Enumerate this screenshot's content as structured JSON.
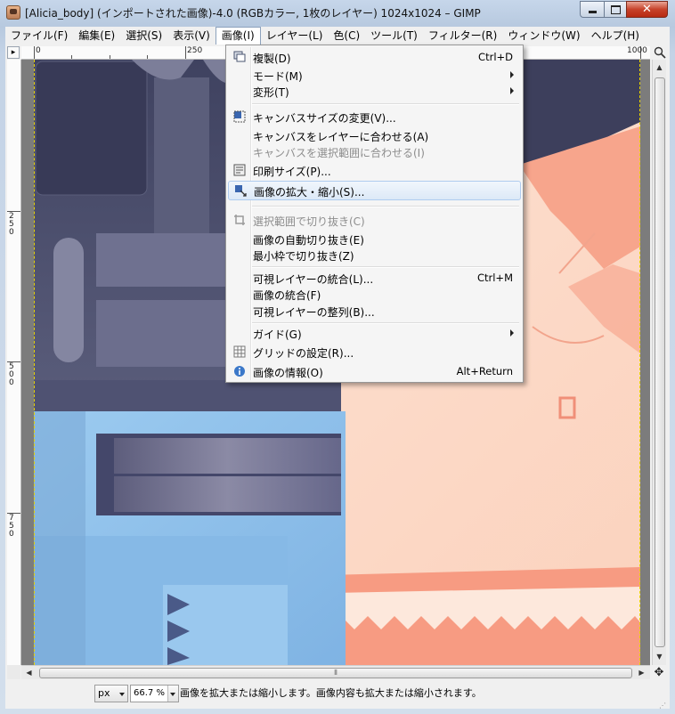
{
  "window": {
    "title": "[Alicia_body] (インポートされた画像)-4.0 (RGBカラー, 1枚のレイヤー) 1024x1024 – GIMP",
    "close_glyph": "✕"
  },
  "menubar": {
    "items": [
      {
        "label": "ファイル(F)"
      },
      {
        "label": "編集(E)"
      },
      {
        "label": "選択(S)"
      },
      {
        "label": "表示(V)"
      },
      {
        "label": "画像(I)"
      },
      {
        "label": "レイヤー(L)"
      },
      {
        "label": "色(C)"
      },
      {
        "label": "ツール(T)"
      },
      {
        "label": "フィルター(R)"
      },
      {
        "label": "ウィンドウ(W)"
      },
      {
        "label": "ヘルプ(H)"
      }
    ]
  },
  "ruler": {
    "corner": "▸",
    "h_labels": [
      "0",
      "250",
      "1000"
    ],
    "v_labels": [
      "250",
      "500",
      "750"
    ]
  },
  "image_menu": {
    "items": [
      {
        "label": "複製(D)",
        "accel": "Ctrl+D",
        "icon": "duplicate-icon"
      },
      {
        "label": "モード(M)",
        "submenu": true
      },
      {
        "label": "変形(T)",
        "submenu": true
      },
      {
        "label": "キャンバスサイズの変更(V)...",
        "icon": "canvas-size-icon"
      },
      {
        "label": "キャンバスをレイヤーに合わせる(A)"
      },
      {
        "label": "キャンバスを選択範囲に合わせる(I)",
        "disabled": true
      },
      {
        "label": "印刷サイズ(P)...",
        "icon": "print-size-icon"
      },
      {
        "label": "画像の拡大・縮小(S)...",
        "icon": "scale-image-icon",
        "highlighted": true
      },
      {
        "label": "選択範囲で切り抜き(C)",
        "icon": "crop-icon",
        "disabled": true
      },
      {
        "label": "画像の自動切り抜き(E)"
      },
      {
        "label": "最小枠で切り抜き(Z)"
      },
      {
        "label": "可視レイヤーの統合(L)...",
        "accel": "Ctrl+M"
      },
      {
        "label": "画像の統合(F)"
      },
      {
        "label": "可視レイヤーの整列(B)..."
      },
      {
        "label": "ガイド(G)",
        "submenu": true
      },
      {
        "label": "グリッドの設定(R)...",
        "icon": "grid-icon"
      },
      {
        "label": "画像の情報(O)",
        "accel": "Alt+Return",
        "icon": "info-icon"
      }
    ]
  },
  "statusbar": {
    "unit": "px",
    "zoom": "66.7 %",
    "message": "画像を拡大または縮小します。画像内容も拡大または縮小されます。"
  },
  "colors": {
    "accent": "#aecbef",
    "close_button": "#c7432b",
    "skin": "#fbd6c2",
    "navy": "#454865",
    "blue": "#8fc0ea"
  }
}
